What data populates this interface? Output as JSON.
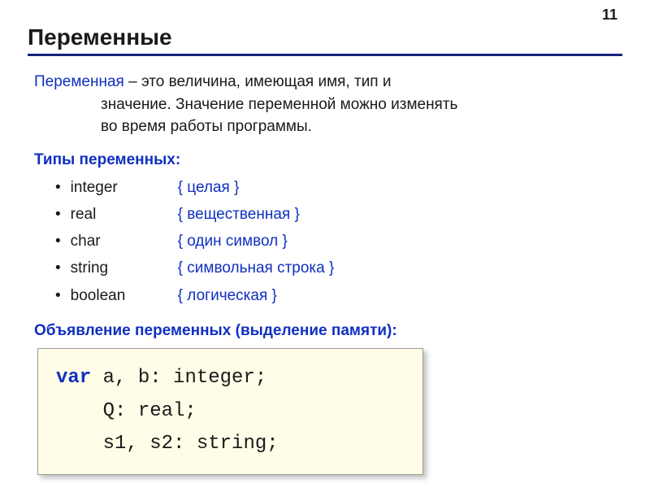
{
  "page_number": "11",
  "title": "Переменные",
  "definition": {
    "term": "Переменная",
    "part1": " – это величина, имеющая имя, тип и",
    "line2": "значение. Значение переменной можно изменять",
    "line3": "во время работы программы."
  },
  "types_section": {
    "label": "Типы переменных:",
    "items": [
      {
        "name": "integer",
        "comment": "{ целая }"
      },
      {
        "name": "real",
        "comment": "{ вещественная }"
      },
      {
        "name": "char",
        "comment": "{ один символ }"
      },
      {
        "name": "string",
        "comment": "{ символьная строка }"
      },
      {
        "name": "boolean",
        "comment": "{ логическая }"
      }
    ]
  },
  "declaration_section": {
    "label": "Объявление переменных (выделение памяти):",
    "code": {
      "kw": "var",
      "line1_rest": " a, b: integer;",
      "line2": "    Q: real;",
      "line3": "    s1, s2: string;"
    }
  }
}
